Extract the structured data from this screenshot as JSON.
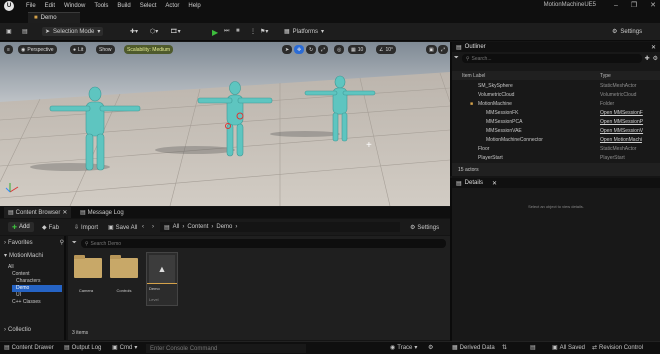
{
  "menu": [
    "File",
    "Edit",
    "Window",
    "Tools",
    "Build",
    "Select",
    "Actor",
    "Help"
  ],
  "app_title": "MotionMachineUE5",
  "level_tab": "Demo",
  "toolbar": {
    "mode": "Selection Mode",
    "platforms": "Platforms",
    "settings": "Settings"
  },
  "viewport": {
    "perspective": "Perspective",
    "lit": "Lit",
    "show": "Show",
    "scalability": "Scalability: Medium",
    "grid": "10",
    "angle": "10°"
  },
  "outliner": {
    "title": "Outliner",
    "search_placeholder": "Search...",
    "col_label": "Item Label",
    "col_type": "Type",
    "rows": [
      {
        "label": "SM_SkySphere",
        "type": "StaticMeshActor"
      },
      {
        "label": "VolumetricCloud",
        "type": "VolumetricCloud"
      },
      {
        "label": "MotionMachine",
        "type": "Folder"
      },
      {
        "label": "MMSessionFK",
        "type": "Open MMSessionF"
      },
      {
        "label": "MMSessionPCA",
        "type": "Open MMSessionP"
      },
      {
        "label": "MMSessionVAE",
        "type": "Open MMSessionV"
      },
      {
        "label": "MotionMachineConnector",
        "type": "Open MotionMachi"
      },
      {
        "label": "Floor",
        "type": "StaticMeshActor"
      },
      {
        "label": "PlayerStart",
        "type": "PlayerStart"
      },
      {
        "label": "SkyLight",
        "type": "SkyLight"
      }
    ],
    "count": "15 actors"
  },
  "details": {
    "title": "Details",
    "empty": "Select an object to view details."
  },
  "content_browser": {
    "tab": "Content Browser",
    "tab2": "Message Log",
    "add": "Add",
    "fab": "Fab",
    "import": "Import",
    "save_all": "Save All",
    "path": [
      "All",
      "Content",
      "Demo"
    ],
    "settings": "Settings",
    "favorites": "Favorites",
    "project": "MotionMachi",
    "search_placeholder": "Search Demo",
    "tree": [
      "All",
      "Content",
      "Characters",
      "Demo",
      "UI",
      "C++ Classes"
    ],
    "collections": "Collectio",
    "items": [
      {
        "name": "Camera"
      },
      {
        "name": "Controls"
      },
      {
        "name": "Demo",
        "sub": "Level"
      }
    ],
    "count": "3 items"
  },
  "status": {
    "drawer": "Content Drawer",
    "output": "Output Log",
    "cmd": "Cmd",
    "console_placeholder": "Enter Console Command",
    "trace": "Trace",
    "derived": "Derived Data",
    "saved": "All Saved",
    "revision": "Revision Control"
  }
}
